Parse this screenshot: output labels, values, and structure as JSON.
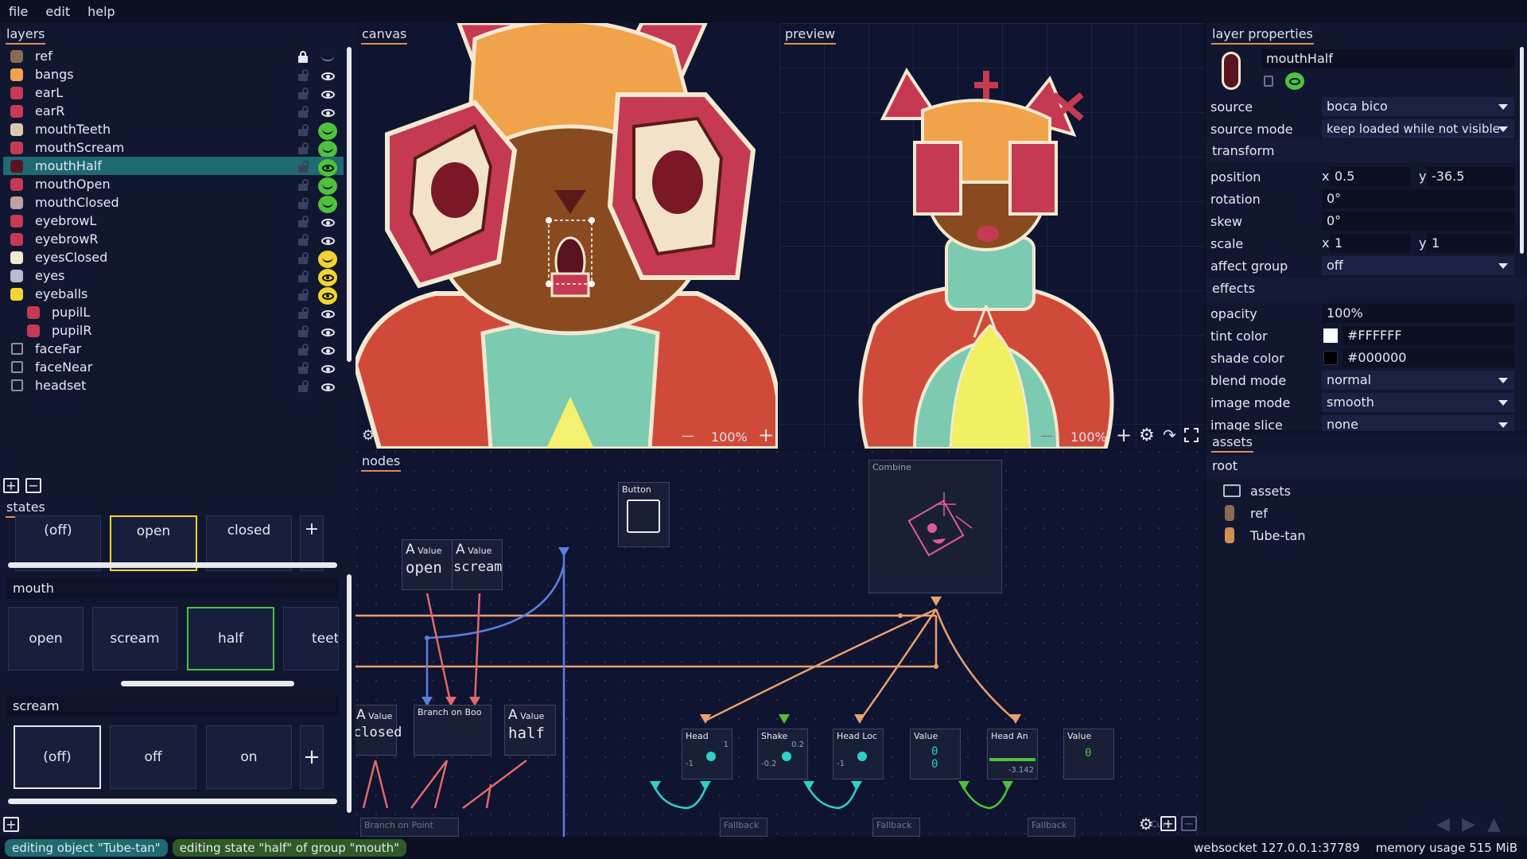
{
  "menu": [
    "file",
    "edit",
    "help"
  ],
  "layers": {
    "title": "layers",
    "items": [
      {
        "name": "ref",
        "locked": true,
        "visible": "closed"
      },
      {
        "name": "bangs",
        "locked": false,
        "visible": "open"
      },
      {
        "name": "earL",
        "locked": false,
        "visible": "open"
      },
      {
        "name": "earR",
        "locked": false,
        "visible": "open"
      },
      {
        "name": "mouthTeeth",
        "locked": false,
        "visible": "green"
      },
      {
        "name": "mouthScream",
        "locked": false,
        "visible": "green"
      },
      {
        "name": "mouthHalf",
        "locked": false,
        "visible": "green-eye",
        "selected": true
      },
      {
        "name": "mouthOpen",
        "locked": false,
        "visible": "green"
      },
      {
        "name": "mouthClosed",
        "locked": false,
        "visible": "green"
      },
      {
        "name": "eyebrowL",
        "locked": false,
        "visible": "open"
      },
      {
        "name": "eyebrowR",
        "locked": false,
        "visible": "open"
      },
      {
        "name": "eyesClosed",
        "locked": false,
        "visible": "yellow"
      },
      {
        "name": "eyes",
        "locked": false,
        "visible": "yellow-eye"
      },
      {
        "name": "eyeballs",
        "locked": false,
        "visible": "yellow-eye"
      },
      {
        "name": "pupilL",
        "locked": false,
        "visible": "open",
        "indent": true
      },
      {
        "name": "pupilR",
        "locked": false,
        "visible": "open",
        "indent": true
      },
      {
        "name": "faceFar",
        "locked": false,
        "visible": "open",
        "folder": true
      },
      {
        "name": "faceNear",
        "locked": false,
        "visible": "open",
        "folder": true
      },
      {
        "name": "headset",
        "locked": false,
        "visible": "open",
        "folder": true
      }
    ]
  },
  "states": {
    "title": "states",
    "top_row": [
      "(off)",
      "open",
      "closed"
    ],
    "groups": [
      {
        "name": "mouth",
        "options": [
          "open",
          "scream",
          "half",
          "teeth"
        ]
      },
      {
        "name": "scream",
        "options": [
          "(off)",
          "off",
          "on"
        ]
      }
    ]
  },
  "canvas": {
    "title": "canvas",
    "zoom": "100%"
  },
  "preview": {
    "title": "preview",
    "zoom": "100%"
  },
  "nodes": {
    "title": "nodes",
    "value_open": "open",
    "value_scream": "scream",
    "value_closed": "closed",
    "value_half": "half",
    "value_label": "Value",
    "button_label": "Button",
    "combine_label": "Combine",
    "branch_bool": "Branch on Boo",
    "branch_point": "Branch on Point",
    "head1": "Head",
    "shake": "Shake",
    "head_loc": "Head Loc",
    "head_an": "Head An",
    "fallback": "Fallback",
    "cursor": "Curs",
    "num_neg1": "-1",
    "num_1": "1",
    "num_0": "0",
    "num_02": "0.2",
    "num_neg02": "-0.2",
    "num_neg3142": "-3.142"
  },
  "properties": {
    "title": "layer properties",
    "layer_name": "mouthHalf",
    "source_label": "source",
    "source": "boca bico",
    "source_mode_label": "source mode",
    "source_mode": "keep loaded while not visible",
    "transform": "transform",
    "position_label": "position",
    "pos_x": "0.5",
    "pos_y": "-36.5",
    "rotation_label": "rotation",
    "rotation": "0°",
    "skew_label": "skew",
    "skew": "0°",
    "scale_label": "scale",
    "scale_x": "1",
    "scale_y": "1",
    "affect_group_label": "affect group",
    "affect_group": "off",
    "effects": "effects",
    "opacity_label": "opacity",
    "opacity": "100%",
    "tint_label": "tint color",
    "tint": "#FFFFFF",
    "shade_label": "shade color",
    "shade": "#000000",
    "blend_label": "blend mode",
    "blend": "normal",
    "image_mode_label": "image mode",
    "image_mode": "smooth",
    "image_slice_label": "image slice",
    "image_slice": "none",
    "x": "x",
    "y": "y"
  },
  "assets": {
    "title": "assets",
    "root": "root",
    "items": [
      "assets",
      "ref",
      "Tube-tan"
    ]
  },
  "status": {
    "editing_object": "editing object \"Tube-tan\"",
    "editing_state": "editing state \"half\" of group \"mouth\"",
    "websocket": "websocket 127.0.0.1:37789",
    "memory": "memory usage 515 MiB"
  },
  "colors": {
    "accent": "#e28b57",
    "green": "#4ec23c",
    "yellow": "#f2d430",
    "teal": "#1e6a73",
    "blue": "#5b7fe0",
    "node_orange": "#e8a070",
    "node_cyan": "#2fd0c8"
  }
}
